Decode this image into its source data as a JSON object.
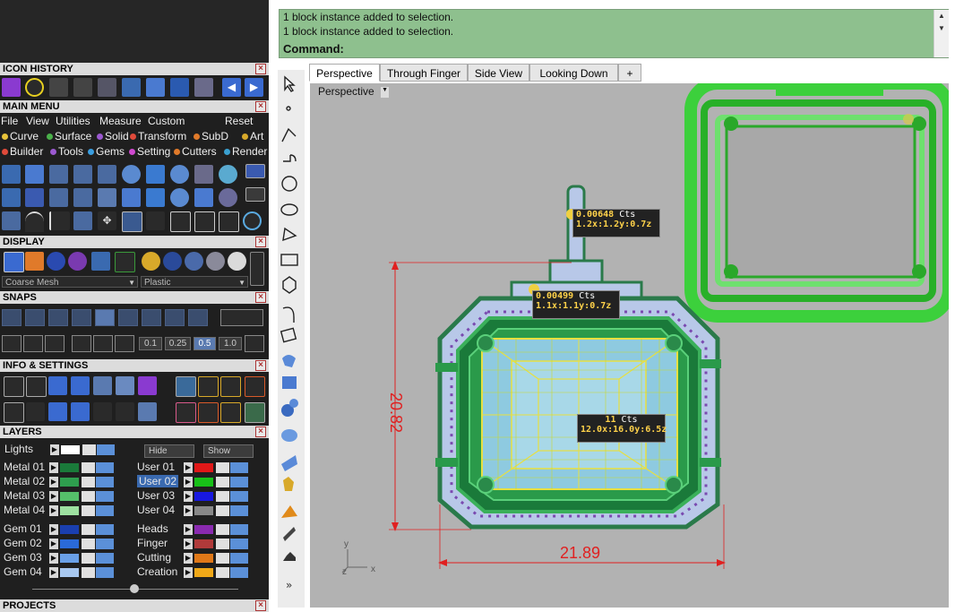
{
  "panels": {
    "icon_history": "ICON HISTORY",
    "main_menu": "MAIN MENU",
    "display": "DISPLAY",
    "snaps": "SNAPS",
    "info_settings": "INFO & SETTINGS",
    "layers": "LAYERS",
    "projects": "PROJECTS"
  },
  "menu": {
    "items": [
      "File",
      "View",
      "Utilities",
      "Measure",
      "Custom"
    ],
    "reset": "Reset"
  },
  "categories": {
    "row1": [
      {
        "label": "Curve",
        "color": "#e8c33a"
      },
      {
        "label": "Surface",
        "color": "#4ab04a"
      },
      {
        "label": "Solid",
        "color": "#9b59d0"
      },
      {
        "label": "Transform",
        "color": "#e04a3a"
      },
      {
        "label": "SubD",
        "color": "#e07a2a"
      },
      {
        "label": "Art",
        "color": "#d8a92a"
      }
    ],
    "row2": [
      {
        "label": "Builder",
        "color": "#e04a3a"
      },
      {
        "label": "Tools",
        "color": "#9b59d0"
      },
      {
        "label": "Gems",
        "color": "#3a9ee0"
      },
      {
        "label": "Setting",
        "color": "#d04ad0"
      },
      {
        "label": "Cutters",
        "color": "#e07a2a"
      },
      {
        "label": "Render",
        "color": "#3aa0d0"
      }
    ]
  },
  "display": {
    "mesh": "Coarse Mesh",
    "material": "Plastic"
  },
  "snaps": {
    "values": [
      "0.1",
      "0.25",
      "0.5",
      "1.0"
    ],
    "selected": "0.5"
  },
  "layers": {
    "lights": "Lights",
    "hide": "Hide",
    "show": "Show",
    "left": [
      {
        "name": "Metal 01",
        "color": "#1a7a3a"
      },
      {
        "name": "Metal 02",
        "color": "#2e9e4e"
      },
      {
        "name": "Metal 03",
        "color": "#55c06a"
      },
      {
        "name": "Metal 04",
        "color": "#9de0a0"
      },
      {
        "name": "Gem 01",
        "color": "#1a3fb0"
      },
      {
        "name": "Gem 02",
        "color": "#2a6ad8"
      },
      {
        "name": "Gem 03",
        "color": "#6aa0e8"
      },
      {
        "name": "Gem 04",
        "color": "#a8c8f0"
      }
    ],
    "right": [
      {
        "name": "User 01",
        "color": "#e01818"
      },
      {
        "name": "User 02",
        "color": "#18c018"
      },
      {
        "name": "User 03",
        "color": "#1818e0"
      },
      {
        "name": "User 04",
        "color": "#888888"
      },
      {
        "name": "Heads",
        "color": "#8a2ab0"
      },
      {
        "name": "Finger",
        "color": "#b03a3a"
      },
      {
        "name": "Cutting",
        "color": "#e07818"
      },
      {
        "name": "Creation",
        "color": "#f0a818"
      }
    ]
  },
  "command": {
    "history": [
      "1 block instance added to selection.",
      "1 block instance added to selection."
    ],
    "prompt": "Command:"
  },
  "viewport": {
    "tabs": [
      "Perspective",
      "Through Finger",
      "Side View",
      "Looking Down"
    ],
    "add_tab": "+",
    "active_tab": "Perspective",
    "label": "Perspective",
    "dim_height": "20.82",
    "dim_width": "21.89",
    "gems": [
      {
        "carat": "0.00648",
        "unit": "Cts",
        "size": "1.2x:1.2y:0.7z"
      },
      {
        "carat": "0.00499",
        "unit": "Cts",
        "size": "1.1x:1.1y:0.7z"
      },
      {
        "carat": "11",
        "unit": "Cts",
        "size": "12.0x:16.0y:6.5z"
      }
    ],
    "axis_y": "y",
    "axis_z": "z",
    "axis_x": "x"
  }
}
